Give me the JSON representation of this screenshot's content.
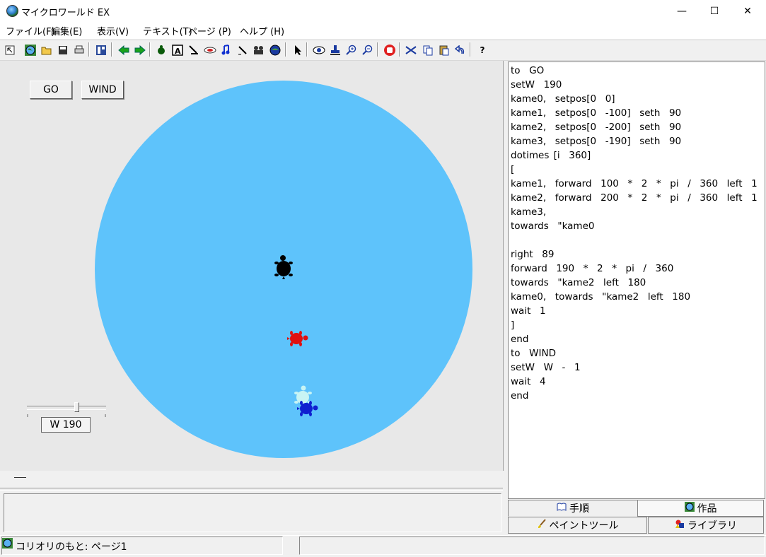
{
  "window": {
    "title": "マイクロワールド EX",
    "minimize_glyph": "—",
    "maximize_glyph": "☐",
    "close_glyph": "✕"
  },
  "menu": [
    {
      "label": "ファイル(F)"
    },
    {
      "label": "編集(E)"
    },
    {
      "label": "表示(V)"
    },
    {
      "label": "テキスト(T)"
    },
    {
      "label": "ページ (P)"
    },
    {
      "label": "ヘルプ (H)"
    }
  ],
  "toolbar": {
    "icons": [
      "pointer-icon",
      "globe-icon",
      "open-folder-icon",
      "save-icon",
      "print-icon",
      "layout-icon",
      "arrow-left-icon",
      "arrow-right-icon",
      "turtle-icon",
      "text-box-icon",
      "paint-icon",
      "button-icon",
      "music-icon",
      "draw-icon",
      "camera-icon",
      "globe-2-icon",
      "select-arrow-icon",
      "eye-icon",
      "stamp-icon",
      "zoom-in-icon",
      "zoom-out-icon",
      "stop-hand-icon",
      "cut-icon",
      "copy-icon",
      "paste-icon",
      "undo-icon",
      "help-icon"
    ],
    "help_glyph": "?",
    "text_glyph": "A"
  },
  "page": {
    "go_button": "GO",
    "wind_button": "WIND",
    "slider_label": "W   190",
    "slider_value": 190,
    "dash_text": ""
  },
  "colors": {
    "pond": "#5ec3fb",
    "turtle0": "#000000",
    "turtle1": "#e01010",
    "turtle2": "#1020d0",
    "turtle3": "#c8f4f4"
  },
  "code_lines": [
    "to  GO",
    "setW  190",
    "kame0,  setpos[0  0]",
    "kame1,  setpos[0  -100]  seth  90",
    "kame2,  setpos[0  -200]  seth  90",
    "kame3,  setpos[0  -190]  seth  90",
    "dotimes [i  360]",
    "[",
    "kame1,  forward  100  *  2  *  pi  /  360  left  1",
    "kame2,  forward  200  *  2  *  pi  /  360  left  1",
    "kame3,",
    "towards  \"kame0",
    "",
    "right  89",
    "forward  190  *  2  *  pi  /  360",
    "towards  \"kame2  left  180",
    "kame0,  towards  \"kame2  left  180",
    "wait  1",
    "]",
    "end",
    "to  WIND",
    "setW  W  -  1",
    "wait  4",
    "end"
  ],
  "tabs": {
    "procedures": "手順",
    "works": "作品",
    "paint_tools": "ペイントツール",
    "library": "ライブラリ"
  },
  "status": {
    "text": "コリオリのもと: ページ1"
  }
}
